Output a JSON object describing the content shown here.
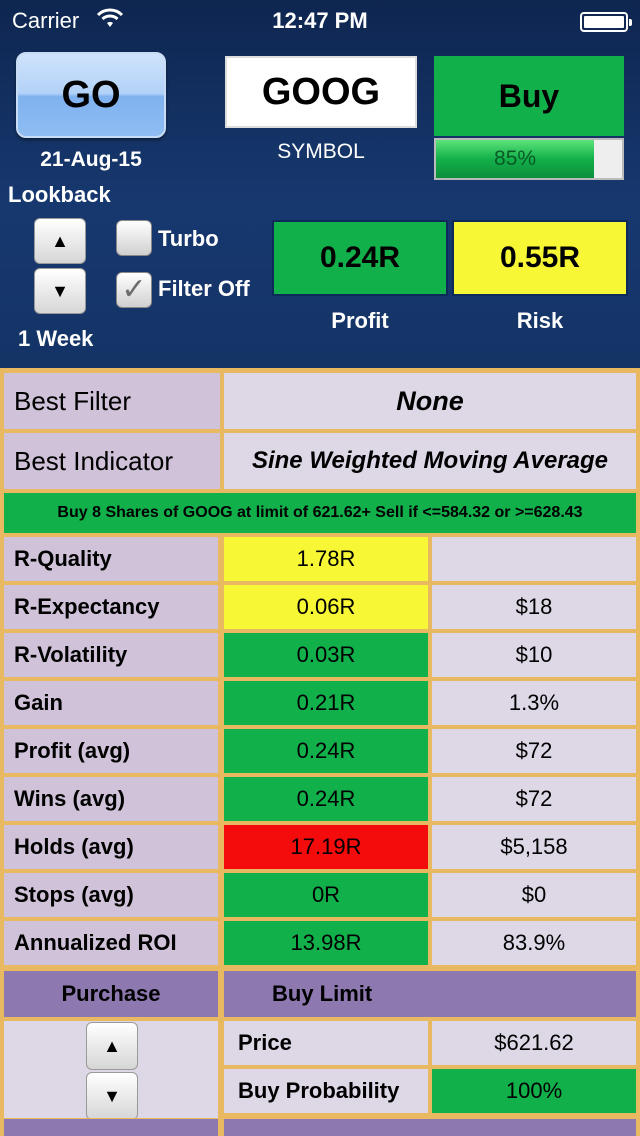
{
  "status_bar": {
    "carrier": "Carrier",
    "time": "12:47 PM"
  },
  "header": {
    "go_label": "GO",
    "date": "21-Aug-15",
    "lookback_label": "Lookback",
    "lookback_value": "1 Week",
    "symbol_value": "GOOG",
    "symbol_label": "SYMBOL",
    "action_label": "Buy",
    "confidence_text": "85%",
    "confidence_fraction": 0.85,
    "turbo_label": "Turbo",
    "turbo_checked": false,
    "filter_off_label": "Filter Off",
    "filter_off_checked": true,
    "profit_value": "0.24R",
    "profit_label": "Profit",
    "risk_value": "0.55R",
    "risk_label": "Risk"
  },
  "summary": {
    "best_filter_label": "Best Filter",
    "best_filter_value": "None",
    "best_indicator_label": "Best Indicator",
    "best_indicator_value": "Sine Weighted Moving Average",
    "recommendation": "Buy 8 Shares of GOOG at limit of 621.62+ Sell if <=584.32 or >=628.43"
  },
  "metrics": [
    {
      "label": "R-Quality",
      "r_value": "1.78R",
      "status": "yellow",
      "amount": ""
    },
    {
      "label": "R-Expectancy",
      "r_value": "0.06R",
      "status": "yellow",
      "amount": "$18"
    },
    {
      "label": "R-Volatility",
      "r_value": "0.03R",
      "status": "green",
      "amount": "$10"
    },
    {
      "label": "Gain",
      "r_value": "0.21R",
      "status": "green",
      "amount": "1.3%"
    },
    {
      "label": "Profit (avg)",
      "r_value": "0.24R",
      "status": "green",
      "amount": "$72"
    },
    {
      "label": "Wins (avg)",
      "r_value": "0.24R",
      "status": "green",
      "amount": "$72"
    },
    {
      "label": "Holds (avg)",
      "r_value": "17.19R",
      "status": "red",
      "amount": "$5,158"
    },
    {
      "label": "Stops (avg)",
      "r_value": "0R",
      "status": "green",
      "amount": "$0"
    },
    {
      "label": "Annualized ROI",
      "r_value": "13.98R",
      "status": "green",
      "amount": "83.9%"
    }
  ],
  "purchase": {
    "header": "Purchase",
    "buy_limit_header": "Buy Limit",
    "price_label": "Price",
    "price_value": "$621.62",
    "buy_prob_label": "Buy Probability",
    "buy_prob_value": "100%"
  },
  "colors": {
    "green": "#12b04a",
    "yellow": "#f7f736",
    "red": "#f40b0b",
    "label_bg": "#cfc2d9",
    "grid": "#e8b960",
    "header_bg": "#143466"
  }
}
